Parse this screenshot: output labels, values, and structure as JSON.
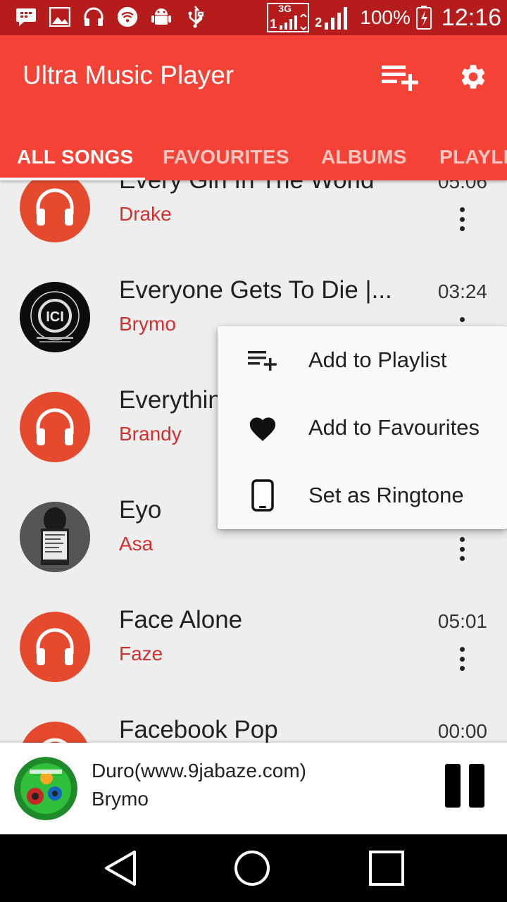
{
  "status_bar": {
    "icons": [
      "bbm-icon",
      "image-icon",
      "headphones-icon",
      "wifi-icon",
      "android-debug-icon",
      "usb-icon"
    ],
    "network_1": "3G",
    "sim_1": "1",
    "sim_2": "2",
    "battery": "100%",
    "time": "12:16"
  },
  "app_bar": {
    "title": "Ultra Music Player",
    "add_playlist_icon": "playlist-add-icon",
    "settings_icon": "gear-icon"
  },
  "tabs": [
    {
      "label": "ALL SONGS",
      "active": true
    },
    {
      "label": "FAVOURITES",
      "active": false
    },
    {
      "label": "ALBUMS",
      "active": false
    },
    {
      "label": "PLAYLISTS",
      "active": false
    }
  ],
  "songs": [
    {
      "title": "Every Girl In The World",
      "artist": "Drake",
      "duration": "05:06",
      "art": "headphones"
    },
    {
      "title": "Everyone Gets To Die |...",
      "artist": "Brymo",
      "duration": "03:24",
      "art": "album"
    },
    {
      "title": "Everything",
      "artist": "Brandy",
      "duration": "",
      "art": "headphones"
    },
    {
      "title": "Eyo",
      "artist": "Asa",
      "duration": "",
      "art": "album"
    },
    {
      "title": "Face Alone",
      "artist": "Faze",
      "duration": "05:01",
      "art": "headphones"
    },
    {
      "title": "Facebook Pop",
      "artist": "",
      "duration": "00:00",
      "art": "headphones"
    }
  ],
  "context_menu": {
    "items": [
      {
        "label": "Add to Playlist",
        "icon": "playlist-add-icon"
      },
      {
        "label": "Add to Favourites",
        "icon": "heart-icon"
      },
      {
        "label": "Set as Ringtone",
        "icon": "phone-icon"
      }
    ]
  },
  "now_playing": {
    "title": "Duro(www.9jabaze.com)",
    "artist": "Brymo",
    "control": "pause-icon"
  },
  "nav_bar": {
    "buttons": [
      "back-icon",
      "home-icon",
      "recents-icon"
    ]
  },
  "colors": {
    "status_bar": "#b71c1c",
    "app_bar": "#f44336",
    "accent_text": "#d32f2f",
    "art_placeholder": "#e64a2e",
    "list_background": "#eeeeee"
  }
}
